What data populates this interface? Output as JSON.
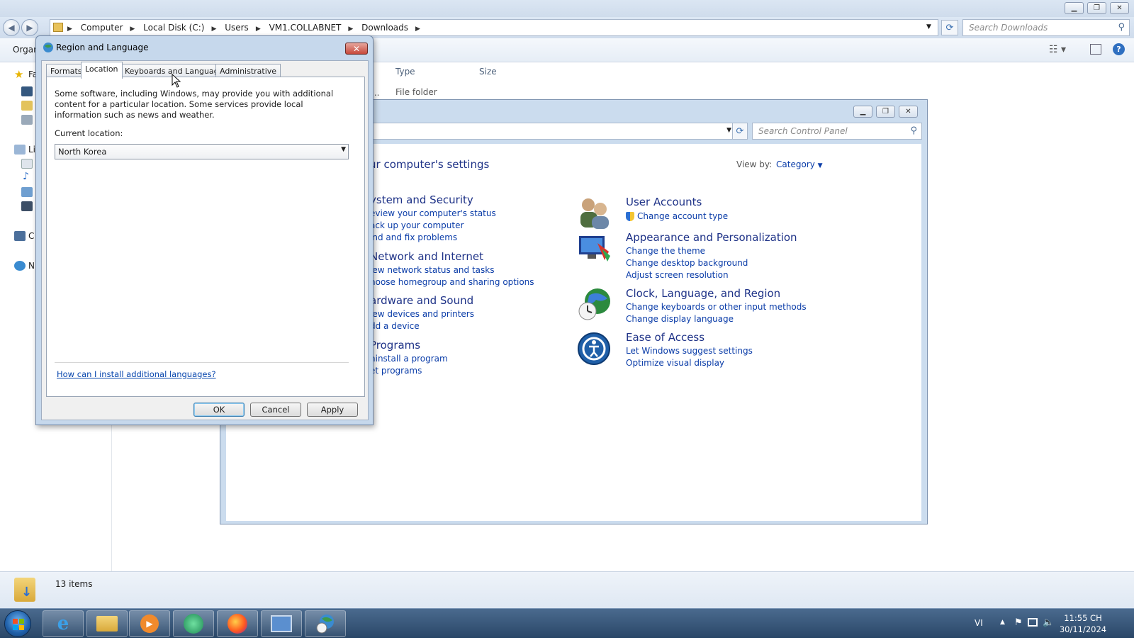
{
  "explorer": {
    "breadcrumb": [
      "Computer",
      "Local Disk (C:)",
      "Users",
      "VM1.COLLABNET",
      "Downloads"
    ],
    "search_placeholder": "Search Downloads",
    "organize_label": "Organ",
    "nav_items": [
      {
        "label": "Fa",
        "icon": "star-icon"
      },
      {
        "label": "Li",
        "icon": "library-icon"
      },
      {
        "label": "C",
        "icon": "computer-icon"
      },
      {
        "label": "N",
        "icon": "network-icon"
      }
    ],
    "columns": [
      "Type",
      "Size"
    ],
    "row_type": "File folder",
    "row_prefix": "...",
    "status_items": "13 items"
  },
  "control_panel": {
    "search_placeholder": "Search Control Panel",
    "heading": "ur computer's settings",
    "view_by_label": "View by:",
    "view_by_value": "Category",
    "left_categories": [
      {
        "title": "ystem and Security",
        "links": [
          "eview your computer's status",
          "ack up your computer",
          "ind and fix problems"
        ]
      },
      {
        "title": "Network and Internet",
        "links": [
          "iew network status and tasks",
          "hoose homegroup and sharing options"
        ]
      },
      {
        "title": "ardware and Sound",
        "links": [
          "iew devices and printers",
          "dd a device"
        ]
      },
      {
        "title": "Programs",
        "links": [
          "ninstall a program",
          "et programs"
        ]
      }
    ],
    "right_categories": [
      {
        "title": "User Accounts",
        "links": [
          "Change account type"
        ],
        "icon": "user-accounts-icon"
      },
      {
        "title": "Appearance and Personalization",
        "links": [
          "Change the theme",
          "Change desktop background",
          "Adjust screen resolution"
        ],
        "icon": "appearance-icon"
      },
      {
        "title": "Clock, Language, and Region",
        "links": [
          "Change keyboards or other input methods",
          "Change display language"
        ],
        "icon": "clock-globe-icon"
      },
      {
        "title": "Ease of Access",
        "links": [
          "Let Windows suggest settings",
          "Optimize visual display"
        ],
        "icon": "ease-of-access-icon"
      }
    ]
  },
  "dialog": {
    "title": "Region and Language",
    "tabs": [
      "Formats",
      "Location",
      "Keyboards and Languages",
      "Administrative"
    ],
    "active_tab": "Location",
    "description": "Some software, including Windows, may provide you with additional content for a particular location. Some services provide local information such as news and weather.",
    "current_location_label": "Current location:",
    "current_location_value": "North Korea",
    "help_link": "How can I install additional languages?",
    "buttons": {
      "ok": "OK",
      "cancel": "Cancel",
      "apply": "Apply"
    }
  },
  "taskbar": {
    "language": "VI",
    "time": "11:55 CH",
    "date": "30/11/2024"
  }
}
